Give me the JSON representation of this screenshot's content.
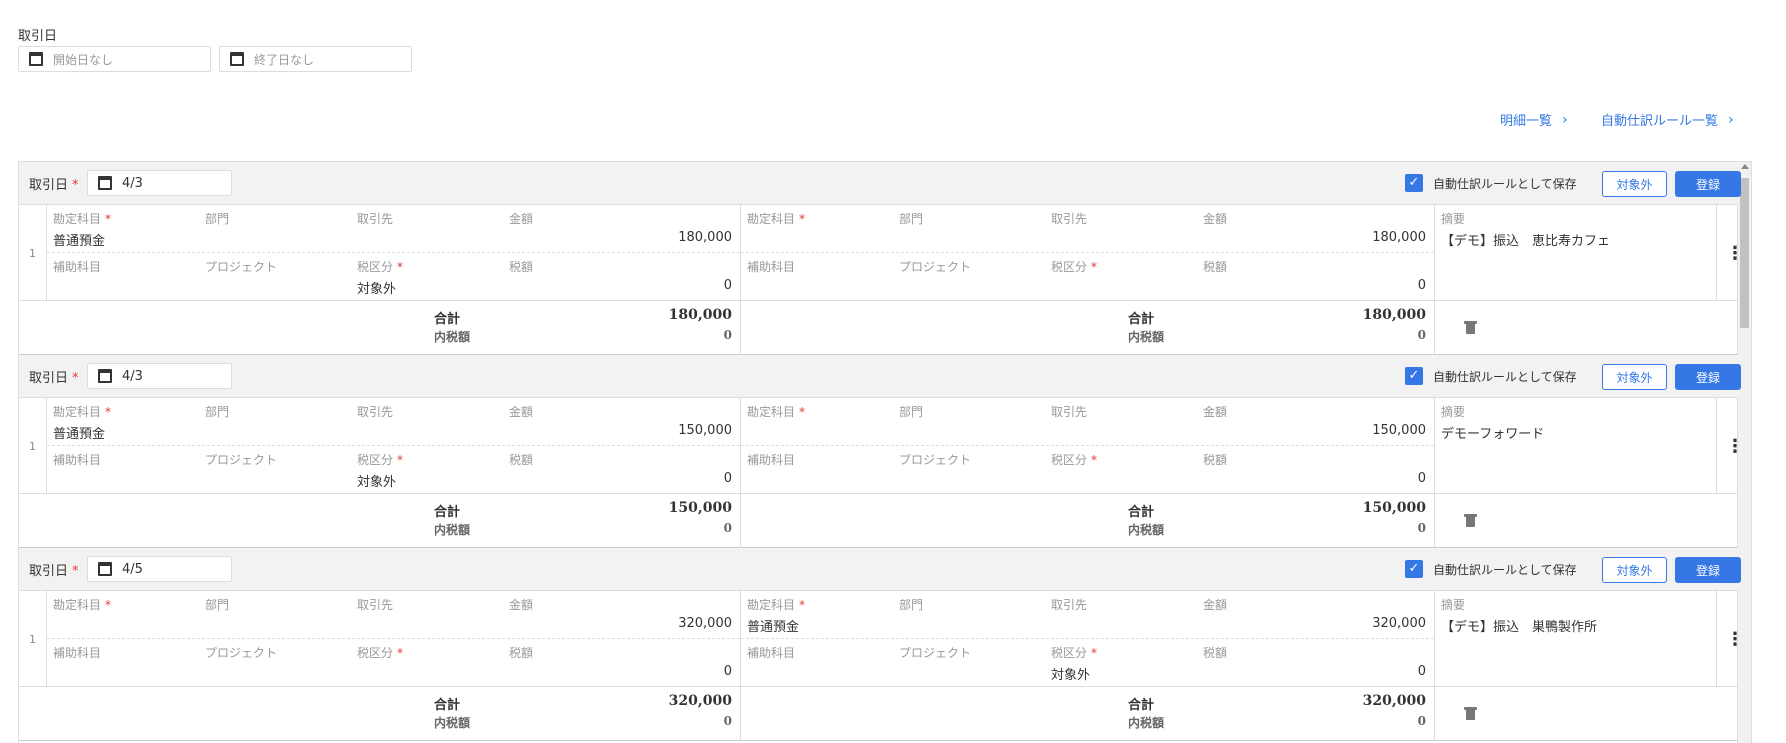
{
  "filter": {
    "label": "取引日",
    "start_placeholder": "開始日なし",
    "end_placeholder": "終了日なし"
  },
  "links": {
    "detail_list": "明細一覧",
    "rule_list": "自動仕訳ルール一覧"
  },
  "labels": {
    "date": "取引日",
    "required_mark": "*",
    "save_as_rule": "自動仕訳ルールとして保存",
    "exclude": "対象外",
    "register": "登録",
    "account": "勘定科目",
    "department": "部門",
    "partner": "取引先",
    "amount": "金額",
    "sub_account": "補助科目",
    "project": "プロジェクト",
    "tax_category": "税区分",
    "tax_amount": "税額",
    "memo": "摘要",
    "total": "合計",
    "inclusive_tax": "内税額"
  },
  "entries": [
    {
      "date": "4/3",
      "row": "1",
      "debit": {
        "account": "普通預金",
        "amount": "180,000",
        "tax_category": "対象外",
        "tax_amount": "0",
        "total": "180,000",
        "inclusive_tax": "0"
      },
      "credit": {
        "account": "",
        "amount": "180,000",
        "tax_category": "",
        "tax_amount": "0",
        "total": "180,000",
        "inclusive_tax": "0"
      },
      "memo": "【デモ】振込　恵比寿カフェ"
    },
    {
      "date": "4/3",
      "row": "1",
      "debit": {
        "account": "普通預金",
        "amount": "150,000",
        "tax_category": "対象外",
        "tax_amount": "0",
        "total": "150,000",
        "inclusive_tax": "0"
      },
      "credit": {
        "account": "",
        "amount": "150,000",
        "tax_category": "",
        "tax_amount": "0",
        "total": "150,000",
        "inclusive_tax": "0"
      },
      "memo": "デモーフォワード"
    },
    {
      "date": "4/5",
      "row": "1",
      "debit": {
        "account": "",
        "amount": "320,000",
        "tax_category": "",
        "tax_amount": "0",
        "total": "320,000",
        "inclusive_tax": "0"
      },
      "credit": {
        "account": "普通預金",
        "amount": "320,000",
        "tax_category": "対象外",
        "tax_amount": "0",
        "total": "320,000",
        "inclusive_tax": "0"
      },
      "memo": "【デモ】振込　巣鴨製作所"
    }
  ],
  "colors": {
    "accent": "#3578e5",
    "required": "#e53935",
    "header_bg": "#f2f2f2"
  }
}
